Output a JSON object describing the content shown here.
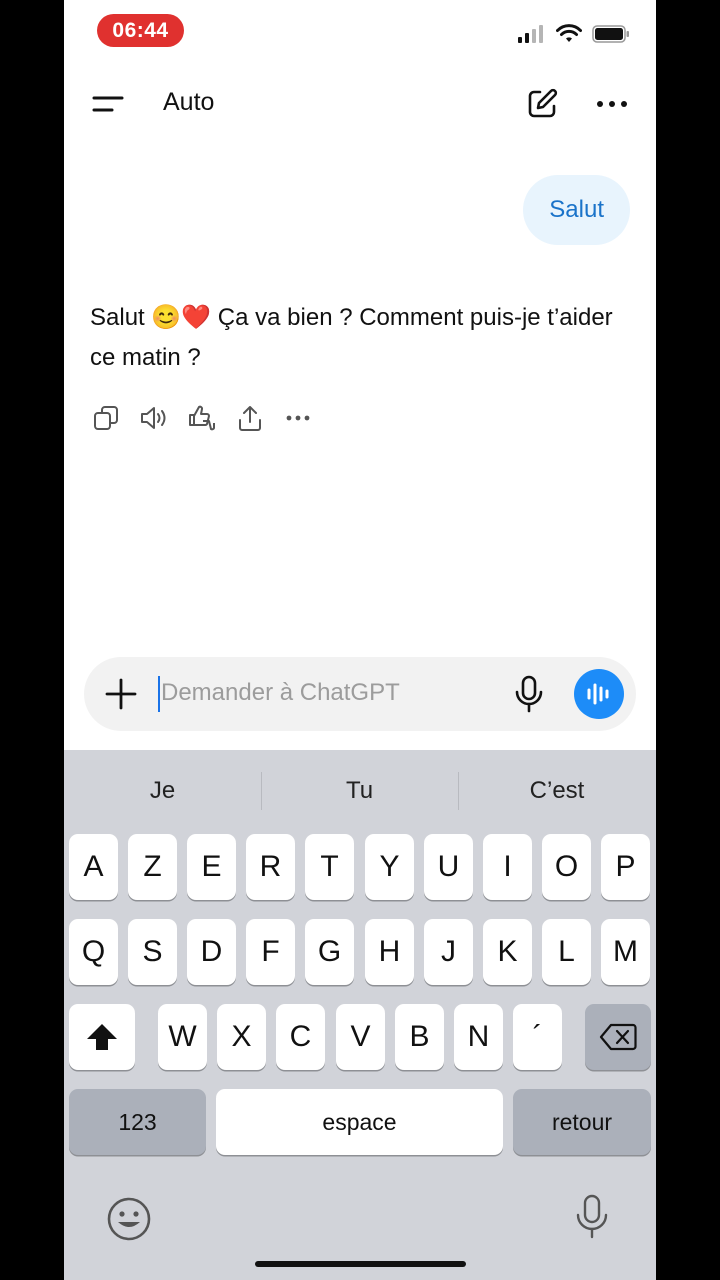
{
  "status_bar": {
    "time": "06:44"
  },
  "header": {
    "title": "Auto"
  },
  "chat": {
    "user_message": "Salut",
    "assistant_message": "Salut 😊❤️ Ça va bien ? Comment puis-je t’aider ce matin ?",
    "actions": [
      "copy-icon",
      "speaker-icon",
      "thumbs-icon",
      "share-icon",
      "more-icon"
    ]
  },
  "input": {
    "placeholder": "Demander à ChatGPT"
  },
  "keyboard": {
    "suggestions": [
      "Je",
      "Tu",
      "C’est"
    ],
    "row1": [
      "A",
      "Z",
      "E",
      "R",
      "T",
      "Y",
      "U",
      "I",
      "O",
      "P"
    ],
    "row2": [
      "Q",
      "S",
      "D",
      "F",
      "G",
      "H",
      "J",
      "K",
      "L",
      "M"
    ],
    "row3": [
      "W",
      "X",
      "C",
      "V",
      "B",
      "N",
      "´"
    ],
    "numbers_label": "123",
    "space_label": "espace",
    "return_label": "retour"
  },
  "colors": {
    "accent": "#1d8cf8",
    "user_bubble_bg": "#e8f4fd",
    "user_bubble_text": "#1a73c9",
    "time_pill": "#e0312f"
  }
}
